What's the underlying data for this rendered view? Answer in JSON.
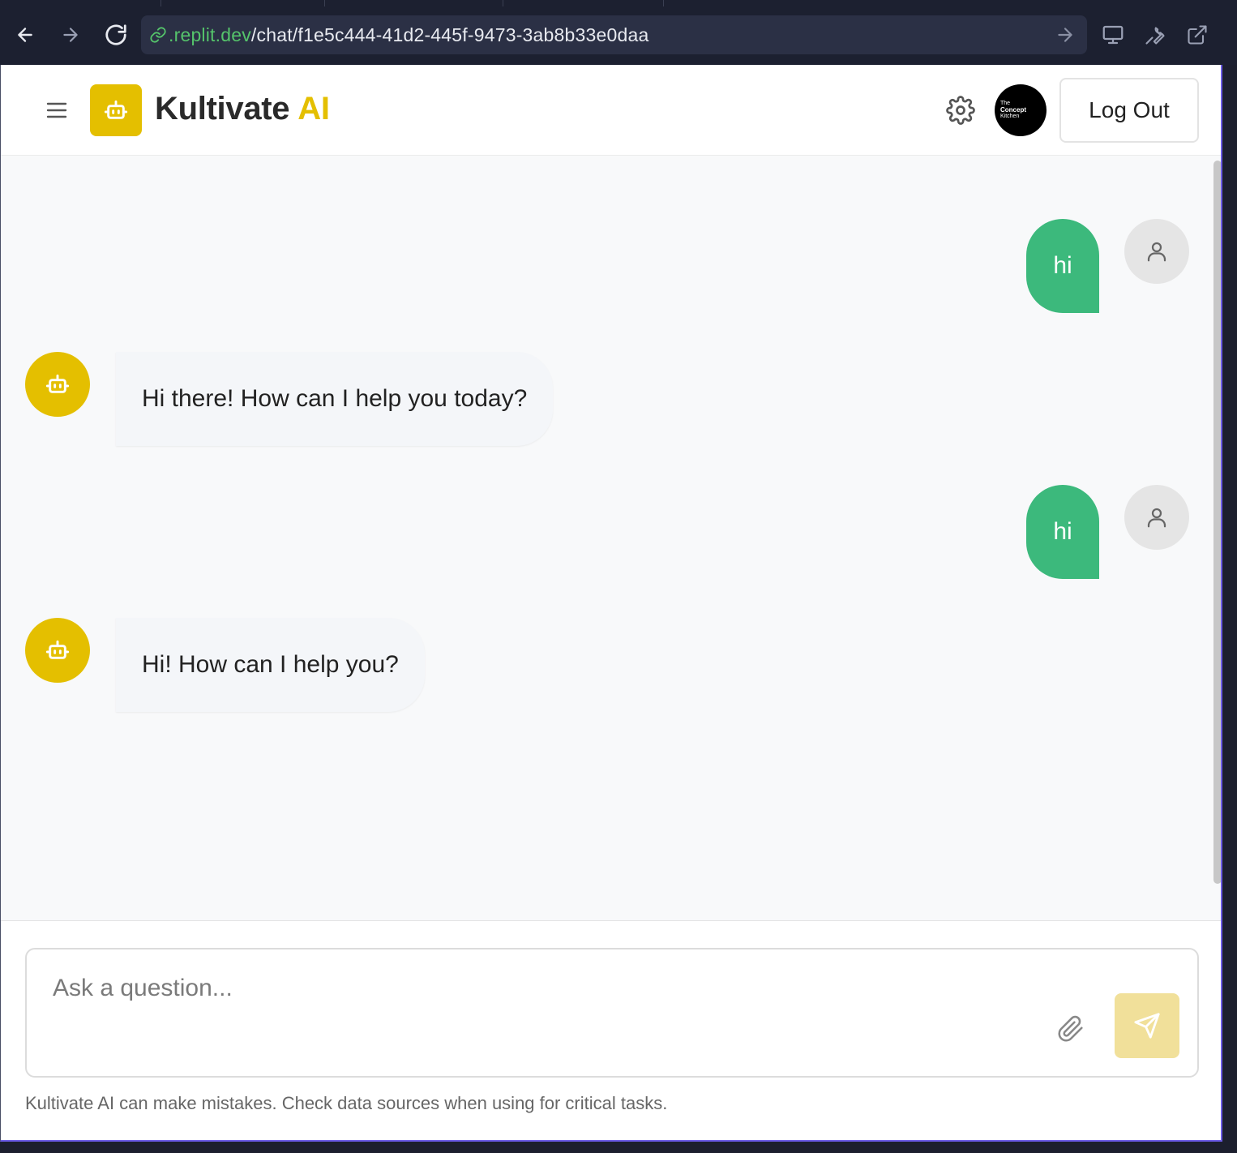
{
  "browser": {
    "url_domain": ".replit.dev",
    "url_path": "/chat/f1e5c444-41d2-445f-9473-3ab8b33e0daa"
  },
  "header": {
    "brand_name": "Kultivate",
    "brand_suffix": "AI",
    "profile_line1": "The",
    "profile_line2": "Concept",
    "profile_line3": "Kitchen",
    "logout_label": "Log Out"
  },
  "messages": [
    {
      "role": "user",
      "text": "hi"
    },
    {
      "role": "assistant",
      "text": "Hi there! How can I help you today?"
    },
    {
      "role": "user",
      "text": "hi"
    },
    {
      "role": "assistant",
      "text": "Hi! How can I help you?"
    }
  ],
  "composer": {
    "placeholder": "Ask a question...",
    "disclaimer": "Kultivate AI can make mistakes. Check data sources when using for critical tasks."
  },
  "colors": {
    "brand_yellow": "#e4bf00",
    "user_bubble": "#3cb97c",
    "send_button_disabled": "#f1e09a"
  }
}
